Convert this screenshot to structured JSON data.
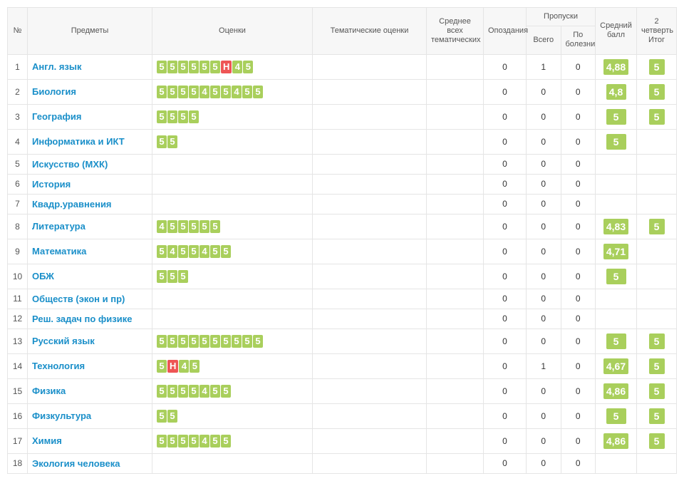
{
  "headers": {
    "num": "№",
    "subject": "Предметы",
    "grades": "Оценки",
    "thematic": "Тематические оценки",
    "avg_thematic": "Среднее всех тематических",
    "late": "Опоздания",
    "absence_group": "Пропуски",
    "absence_total": "Всего",
    "absence_sick": "По болезни",
    "avg": "Средний балл",
    "quarter2": "2 четверть Итог"
  },
  "rows": [
    {
      "n": 1,
      "subject": "Англ. язык",
      "grades": [
        "5",
        "5",
        "5",
        "5",
        "5",
        "5",
        "Н",
        "4",
        "5"
      ],
      "late": "0",
      "abs_t": "1",
      "abs_s": "0",
      "avg": "4,88",
      "q2": "5"
    },
    {
      "n": 2,
      "subject": "Биология",
      "grades": [
        "5",
        "5",
        "5",
        "5",
        "4",
        "5",
        "5",
        "4",
        "5",
        "5"
      ],
      "late": "0",
      "abs_t": "0",
      "abs_s": "0",
      "avg": "4,8",
      "q2": "5"
    },
    {
      "n": 3,
      "subject": "География",
      "grades": [
        "5",
        "5",
        "5",
        "5"
      ],
      "late": "0",
      "abs_t": "0",
      "abs_s": "0",
      "avg": "5",
      "q2": "5"
    },
    {
      "n": 4,
      "subject": "Информатика и ИКТ",
      "grades": [
        "5",
        "5"
      ],
      "late": "0",
      "abs_t": "0",
      "abs_s": "0",
      "avg": "5",
      "q2": ""
    },
    {
      "n": 5,
      "subject": "Искусство (МХК)",
      "grades": [],
      "late": "0",
      "abs_t": "0",
      "abs_s": "0",
      "avg": "",
      "q2": ""
    },
    {
      "n": 6,
      "subject": "История",
      "grades": [],
      "late": "0",
      "abs_t": "0",
      "abs_s": "0",
      "avg": "",
      "q2": ""
    },
    {
      "n": 7,
      "subject": "Квадр.уравнения",
      "grades": [],
      "late": "0",
      "abs_t": "0",
      "abs_s": "0",
      "avg": "",
      "q2": ""
    },
    {
      "n": 8,
      "subject": "Литература",
      "grades": [
        "4",
        "5",
        "5",
        "5",
        "5",
        "5"
      ],
      "late": "0",
      "abs_t": "0",
      "abs_s": "0",
      "avg": "4,83",
      "q2": "5"
    },
    {
      "n": 9,
      "subject": "Математика",
      "grades": [
        "5",
        "4",
        "5",
        "5",
        "4",
        "5",
        "5"
      ],
      "late": "0",
      "abs_t": "0",
      "abs_s": "0",
      "avg": "4,71",
      "q2": ""
    },
    {
      "n": 10,
      "subject": "ОБЖ",
      "grades": [
        "5",
        "5",
        "5"
      ],
      "late": "0",
      "abs_t": "0",
      "abs_s": "0",
      "avg": "5",
      "q2": ""
    },
    {
      "n": 11,
      "subject": "Обществ (экон и пр)",
      "grades": [],
      "late": "0",
      "abs_t": "0",
      "abs_s": "0",
      "avg": "",
      "q2": ""
    },
    {
      "n": 12,
      "subject": "Реш. задач по физике",
      "grades": [],
      "late": "0",
      "abs_t": "0",
      "abs_s": "0",
      "avg": "",
      "q2": ""
    },
    {
      "n": 13,
      "subject": "Русский язык",
      "grades": [
        "5",
        "5",
        "5",
        "5",
        "5",
        "5",
        "5",
        "5",
        "5",
        "5"
      ],
      "late": "0",
      "abs_t": "0",
      "abs_s": "0",
      "avg": "5",
      "q2": "5"
    },
    {
      "n": 14,
      "subject": "Технология",
      "grades": [
        "5",
        "Н",
        "4",
        "5"
      ],
      "late": "0",
      "abs_t": "1",
      "abs_s": "0",
      "avg": "4,67",
      "q2": "5"
    },
    {
      "n": 15,
      "subject": "Физика",
      "grades": [
        "5",
        "5",
        "5",
        "5",
        "4",
        "5",
        "5"
      ],
      "late": "0",
      "abs_t": "0",
      "abs_s": "0",
      "avg": "4,86",
      "q2": "5"
    },
    {
      "n": 16,
      "subject": "Физкультура",
      "grades": [
        "5",
        "5"
      ],
      "late": "0",
      "abs_t": "0",
      "abs_s": "0",
      "avg": "5",
      "q2": "5"
    },
    {
      "n": 17,
      "subject": "Химия",
      "grades": [
        "5",
        "5",
        "5",
        "5",
        "4",
        "5",
        "5"
      ],
      "late": "0",
      "abs_t": "0",
      "abs_s": "0",
      "avg": "4,86",
      "q2": "5"
    },
    {
      "n": 18,
      "subject": "Экология человека",
      "grades": [],
      "late": "0",
      "abs_t": "0",
      "abs_s": "0",
      "avg": "",
      "q2": ""
    }
  ]
}
